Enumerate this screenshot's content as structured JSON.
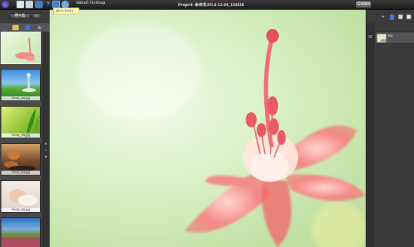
{
  "topbar": {
    "app_title": "Gilisoft PicShop",
    "project_title": "Project: 未命名2014-12-24_134118",
    "create_label": "Create",
    "tooltip": "go to forum"
  },
  "left_panel": {
    "tab_label": "照片集",
    "thumbnails": [
      {
        "label": ""
      },
      {
        "label": "Photo_02.jpg"
      },
      {
        "label": "Photo_03.jpg"
      },
      {
        "label": "Photo_04.jpg"
      },
      {
        "label": "Photo_05.jpg"
      },
      {
        "label": ""
      }
    ]
  },
  "right_panel": {
    "layer_label": "Pic"
  },
  "colors": {
    "accent": "#f06a6a",
    "canvas_bg": "#d8efc4",
    "tooltip_bg": "#fbf7b0"
  }
}
